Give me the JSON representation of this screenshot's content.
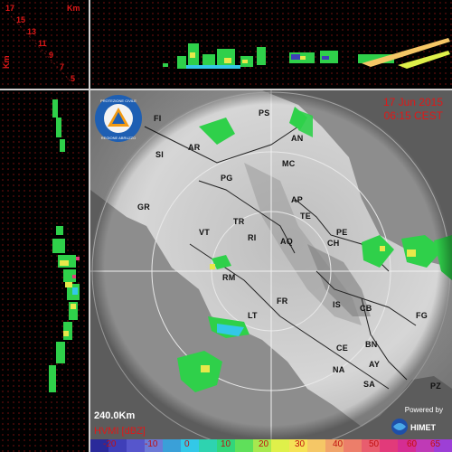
{
  "height_panel": {
    "units": "Km",
    "top_value": "17",
    "levels": [
      "15",
      "13",
      "11",
      "9",
      "7",
      "5"
    ]
  },
  "map": {
    "date": "17 Jun 2015",
    "time": "06:15 CEST",
    "range": "240.0Km",
    "cities": [
      {
        "name": "FI"
      },
      {
        "name": "PS"
      },
      {
        "name": "AN"
      },
      {
        "name": "SI"
      },
      {
        "name": "AR"
      },
      {
        "name": "MC"
      },
      {
        "name": "PG"
      },
      {
        "name": "GR"
      },
      {
        "name": "AP"
      },
      {
        "name": "TE"
      },
      {
        "name": "TR"
      },
      {
        "name": "VT"
      },
      {
        "name": "RI"
      },
      {
        "name": "PE"
      },
      {
        "name": "AQ"
      },
      {
        "name": "CH"
      },
      {
        "name": "RM"
      },
      {
        "name": "IS"
      },
      {
        "name": "FR"
      },
      {
        "name": "CB"
      },
      {
        "name": "FG"
      },
      {
        "name": "LT"
      },
      {
        "name": "CE"
      },
      {
        "name": "BN"
      },
      {
        "name": "AY"
      },
      {
        "name": "NA"
      },
      {
        "name": "SA"
      },
      {
        "name": "PZ"
      }
    ]
  },
  "logo": {
    "text_top": "PROTEZIONE CIVILE",
    "text_bottom": "REGIONE ABRUZZO"
  },
  "brand": {
    "powered_label": "Powered by",
    "name": "HIMET"
  },
  "legend": {
    "unit_label": "HVMI [dBZ]",
    "ticks": [
      "-20",
      "-10",
      "0",
      "10",
      "20",
      "30",
      "40",
      "50",
      "60",
      "65"
    ],
    "colors": [
      "#2a2a9a",
      "#3f3fb8",
      "#5656cc",
      "#6c7ad6",
      "#3aa0d8",
      "#33c8e8",
      "#2ed3b0",
      "#32d67a",
      "#5fe05a",
      "#a7e84f",
      "#dff04a",
      "#f6e256",
      "#f5c766",
      "#f0a46a",
      "#ec7e6a",
      "#e85d6e",
      "#e23a7a",
      "#d52d92",
      "#bf3ab6",
      "#9d3fd6"
    ]
  },
  "colors": {
    "accent_red": "#e01818",
    "echo_green": "#2fd04a",
    "echo_yellow": "#e8e84a"
  }
}
